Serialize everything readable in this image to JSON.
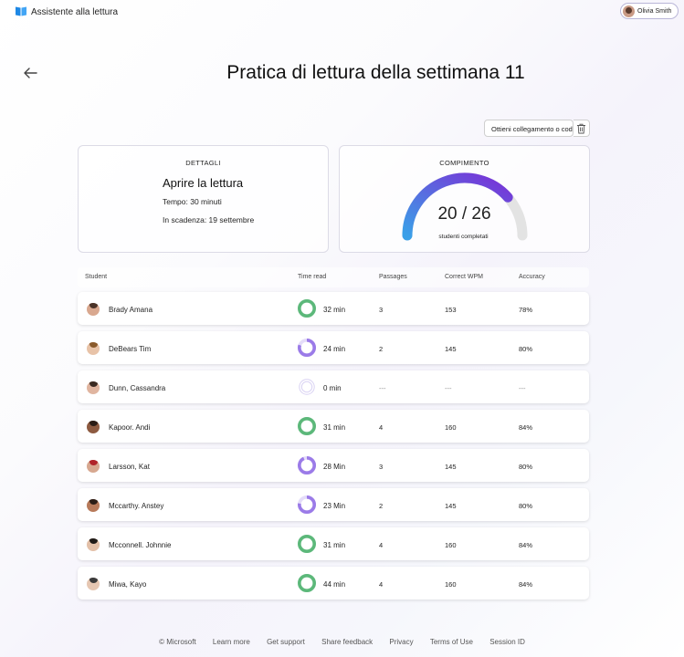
{
  "app": {
    "name": "Assistente alla lettura",
    "user_name": "Olivia Smith"
  },
  "page": {
    "title": "Pratica di lettura della settimana 11"
  },
  "actions": {
    "get_link_label": "Ottieni collegamento o cod"
  },
  "details": {
    "label": "DETTAGLI",
    "heading": "Aprire la lettura",
    "time": "Tempo: 30 minuti",
    "due": "In scadenza: 19 settembre"
  },
  "completion": {
    "label": "COMPIMENTO",
    "value_text": "20 / 26",
    "completed": 20,
    "total": 26,
    "caption": "studenti completati",
    "colors": {
      "start": "#3aa0e8",
      "end": "#7b2fd6",
      "track": "#e3e3e3"
    }
  },
  "table": {
    "headers": {
      "student": "Student",
      "time": "Time read",
      "passages": "Passages",
      "wpm": "Correct WPM",
      "accuracy": "Accuracy"
    },
    "rows": [
      {
        "name": "Brady Amana",
        "time": "32 min",
        "progress": 1.0,
        "passages": "3",
        "wpm": "153",
        "accuracy": "78%",
        "complete": true
      },
      {
        "name": "DeBears Tim",
        "time": "24 min",
        "progress": 0.8,
        "passages": "2",
        "wpm": "145",
        "accuracy": "80%",
        "complete": false
      },
      {
        "name": "Dunn, Cassandra",
        "time": "0 min",
        "progress": 0.0,
        "passages": "---",
        "wpm": "---",
        "accuracy": "---",
        "complete": false
      },
      {
        "name": "Kapoor. Andi",
        "time": "31 min",
        "progress": 1.0,
        "passages": "4",
        "wpm": "160",
        "accuracy": "84%",
        "complete": true
      },
      {
        "name": "Larsson, Kat",
        "time": "28 Min",
        "progress": 0.93,
        "passages": "3",
        "wpm": "145",
        "accuracy": "80%",
        "complete": false
      },
      {
        "name": "Mccarthy. Anstey",
        "time": "23 Min",
        "progress": 0.77,
        "passages": "2",
        "wpm": "145",
        "accuracy": "80%",
        "complete": false
      },
      {
        "name": "Mcconnell. Johnnie",
        "time": "31 min",
        "progress": 1.0,
        "passages": "4",
        "wpm": "160",
        "accuracy": "84%",
        "complete": true
      },
      {
        "name": "Miwa, Kayo",
        "time": "44 min",
        "progress": 1.0,
        "passages": "4",
        "wpm": "160",
        "accuracy": "84%",
        "complete": true
      }
    ]
  },
  "colors": {
    "complete_ring": "#5cb87a",
    "partial_ring": "#9b7be8",
    "partial_track": "#e4dcf9"
  },
  "footer": {
    "copyright": "© Microsoft",
    "links": [
      "Learn more",
      "Get support",
      "Share feedback",
      "Privacy",
      "Terms of Use",
      "Session ID"
    ]
  }
}
